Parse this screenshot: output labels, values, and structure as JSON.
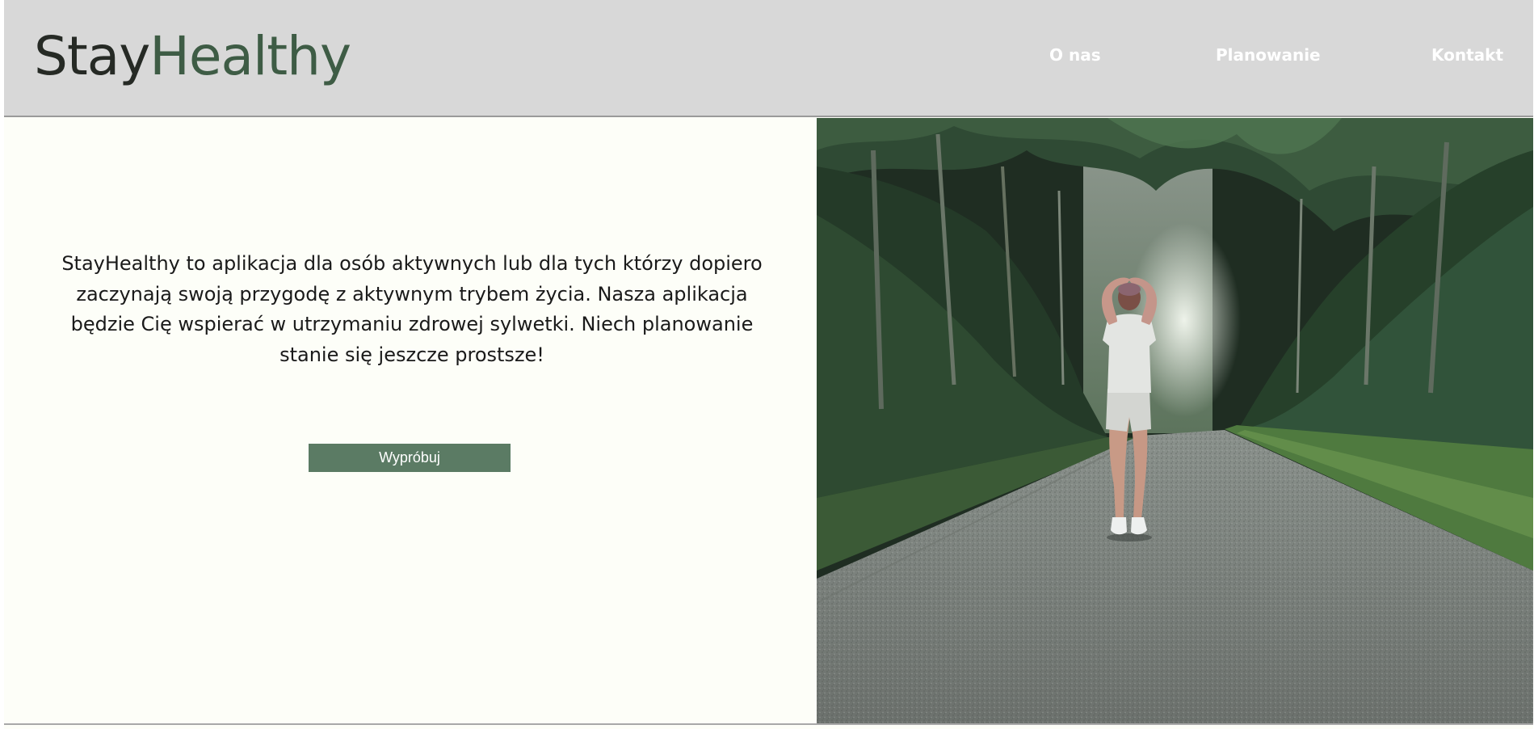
{
  "header": {
    "logo": {
      "part1": "Stay",
      "part2": "Healthy"
    },
    "nav": [
      {
        "label": "O nas"
      },
      {
        "label": "Planowanie"
      },
      {
        "label": "Kontakt"
      }
    ]
  },
  "main": {
    "intro_text": "StayHealthy to aplikacja dla osób aktywnych lub dla tych którzy dopiero zaczynają swoją przygodę z aktywnym trybem życia. Nasza aplikacja będzie Cię wspierać w utrzymaniu zdrowej sylwetki. Niech planowanie stanie się jeszcze prostsze!",
    "cta_label": "Wypróbuj"
  },
  "colors": {
    "header_bg": "#d8d8d8",
    "logo_dark": "#262a25",
    "logo_accent": "#3e5c45",
    "page_bg": "#fdfef8",
    "button_bg": "#5b7b64",
    "nav_text": "#ffffff"
  },
  "hero_image": {
    "subject": "woman-walking-on-forest-road"
  }
}
